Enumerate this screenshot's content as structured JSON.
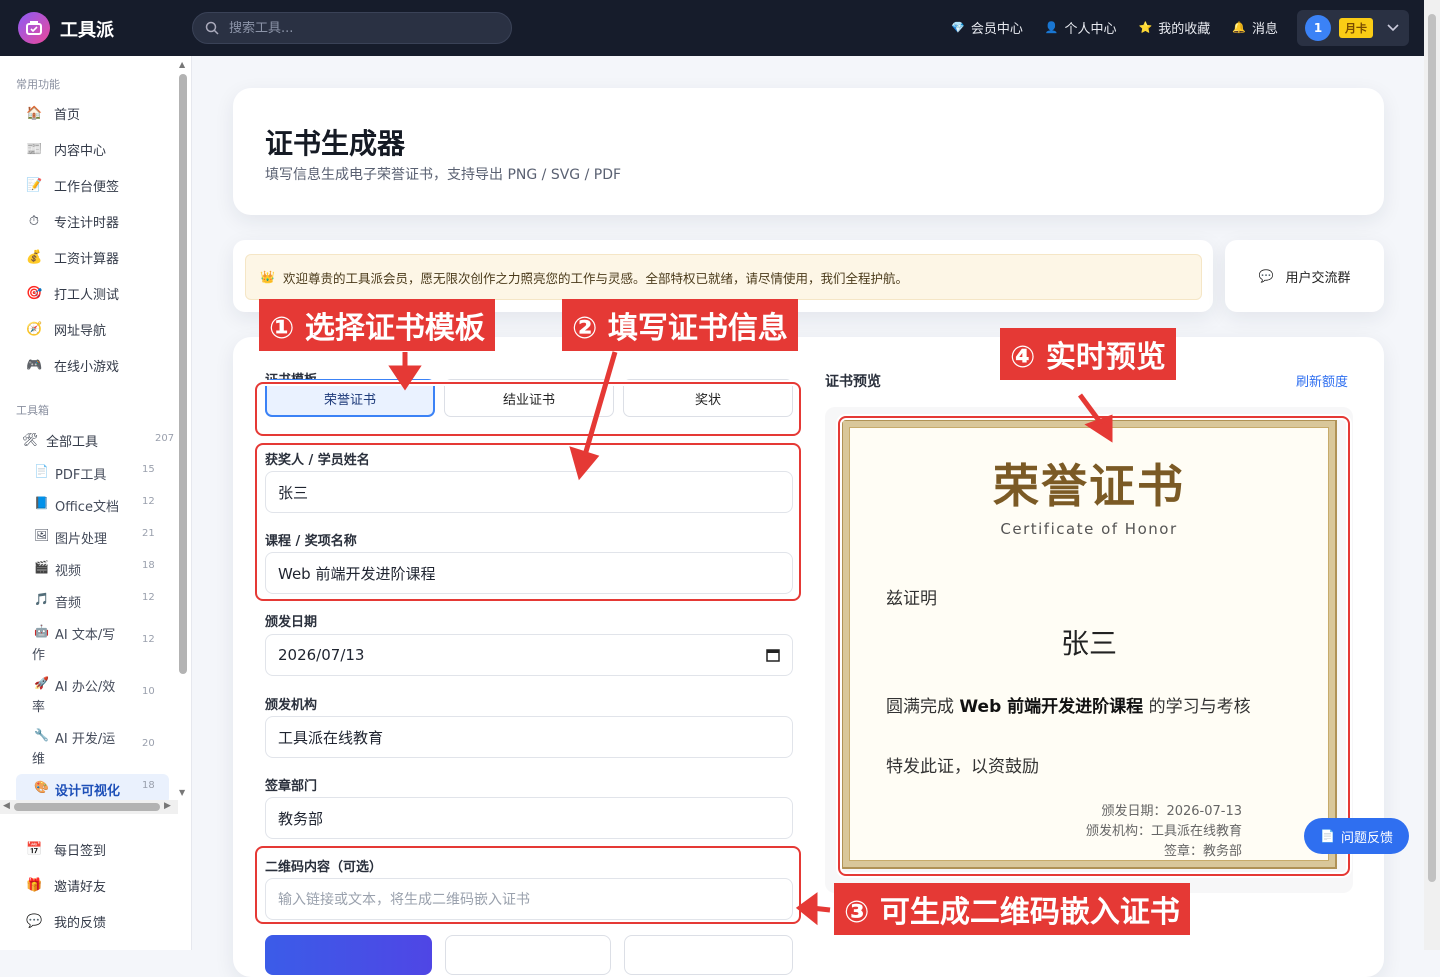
{
  "topbar": {
    "app_name": "工具派",
    "search_placeholder": "搜索工具...",
    "nav": [
      {
        "icon": "diamond-icon",
        "glyph": "💎",
        "label": "会员中心"
      },
      {
        "icon": "user-icon",
        "glyph": "👤",
        "label": "个人中心"
      },
      {
        "icon": "star-icon",
        "glyph": "⭐",
        "label": "我的收藏"
      },
      {
        "icon": "bell-icon",
        "glyph": "🔔",
        "label": "消息"
      }
    ],
    "avatar_text": "1",
    "membership_badge": "月卡"
  },
  "sidebar": {
    "section_common": "常用功能",
    "common": [
      {
        "glyph": "🏠",
        "label": "首页"
      },
      {
        "glyph": "📰",
        "label": "内容中心"
      },
      {
        "glyph": "📝",
        "label": "工作台便签"
      },
      {
        "glyph": "⏱",
        "label": "专注计时器"
      },
      {
        "glyph": "💰",
        "label": "工资计算器"
      },
      {
        "glyph": "🎯",
        "label": "打工人测试"
      },
      {
        "glyph": "🧭",
        "label": "网址导航"
      },
      {
        "glyph": "🎮",
        "label": "在线小游戏"
      }
    ],
    "section_tools": "工具箱",
    "all_tools": {
      "label": "全部工具",
      "count": "207"
    },
    "tools": [
      {
        "glyph": "📄",
        "label": "PDF工具",
        "count": "15"
      },
      {
        "glyph": "📘",
        "label": "Office文档",
        "count": "12"
      },
      {
        "glyph": "🖼",
        "label": "图片处理",
        "count": "21"
      },
      {
        "glyph": "🎬",
        "label": "视频",
        "count": "18"
      },
      {
        "glyph": "🎵",
        "label": "音频",
        "count": "12"
      },
      {
        "glyph": "🤖",
        "label": "AI 文本/写",
        "label2": "作",
        "count": "12"
      },
      {
        "glyph": "🚀",
        "label": "AI 办公/效",
        "label2": "率",
        "count": "10"
      },
      {
        "glyph": "🔧",
        "label": "AI 开发/运",
        "label2": "维",
        "count": "20"
      },
      {
        "glyph": "🎨",
        "label": "设计可视化",
        "count": "18"
      }
    ],
    "bottom": [
      {
        "glyph": "📅",
        "label": "每日签到"
      },
      {
        "glyph": "🎁",
        "label": "邀请好友"
      },
      {
        "glyph": "💬",
        "label": "我的反馈"
      }
    ]
  },
  "header": {
    "title": "证书生成器",
    "subtitle": "填写信息生成电子荣誉证书，支持导出 PNG / SVG / PDF"
  },
  "banner": {
    "text": "欢迎尊贵的工具派会员，愿无限次创作之力照亮您的工作与灵感。全部特权已就绪，请尽情使用，我们全程护航。"
  },
  "community": {
    "label": "用户交流群"
  },
  "form": {
    "template_label": "证书模板",
    "templates": [
      "荣誉证书",
      "结业证书",
      "奖状"
    ],
    "name_label": "获奖人 / 学员姓名",
    "name_value": "张三",
    "course_label": "课程 / 奖项名称",
    "course_value": "Web 前端开发进阶课程",
    "date_label": "颁发日期",
    "date_value": "2026/07/13",
    "org_label": "颁发机构",
    "org_value": "工具派在线教育",
    "seal_label": "签章部门",
    "seal_value": "教务部",
    "qr_label": "二维码内容（可选）",
    "qr_placeholder": "输入链接或文本，将生成二维码嵌入证书"
  },
  "preview": {
    "label": "证书预览",
    "refresh": "刷新额度",
    "cert_title": "荣誉证书",
    "cert_subtitle": "Certificate of Honor",
    "line1": "兹证明",
    "name": "张三",
    "line2_prefix": "圆满完成 ",
    "line2_course": "Web 前端开发进阶课程",
    "line2_suffix": " 的学习与考核",
    "line3": "特发此证，以资鼓励",
    "meta_date": "颁发日期：2026-07-13",
    "meta_org": "颁发机构：工具派在线教育",
    "meta_seal": "签章：教务部"
  },
  "annotations": {
    "a1": "① 选择证书模板",
    "a2": "② 填写证书信息",
    "a3": "③ 可生成二维码嵌入证书",
    "a4": "④ 实时预览"
  },
  "feedback": {
    "label": "问题反馈"
  },
  "colors": {
    "topbar": "#161c2b",
    "accent": "#3b82f6",
    "annotation": "#e53935",
    "cert_gold": "#7b5a25"
  }
}
